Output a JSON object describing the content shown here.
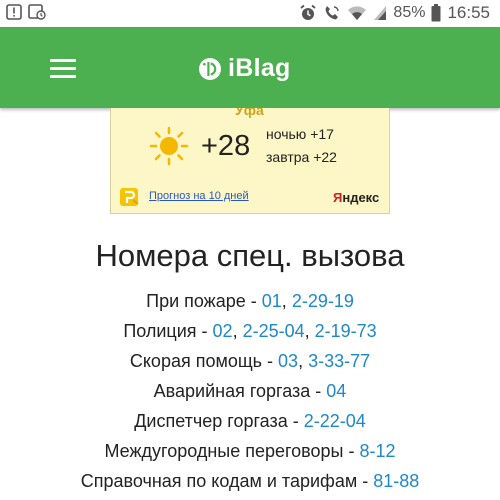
{
  "status_bar": {
    "battery_percent": "85%",
    "time": "16:55",
    "left_icons": [
      "warning-icon",
      "gallery-icon"
    ],
    "right_icons": [
      "alarm-icon",
      "call-icon",
      "wifi-icon",
      "signal-icon",
      "battery-icon"
    ]
  },
  "app_bar": {
    "title": "iBlag",
    "menu_icon": "hamburger-menu-icon",
    "logo_icon": "iblag-logo-icon",
    "background_color": "#4caf50"
  },
  "weather": {
    "city": "Уфа",
    "temperature": "+28",
    "night": "ночью +17",
    "tomorrow": "завтра +22",
    "forecast_link": "Прогноз на 10 дней",
    "provider": "Яндекс",
    "provider_first_letter": "Я",
    "provider_rest": "ндекс"
  },
  "section": {
    "title": "Номера спец. вызова",
    "link_color": "#1e88c8"
  },
  "rows": [
    {
      "label": "При пожаре - ",
      "numbers": [
        "01",
        "2-29-19"
      ]
    },
    {
      "label": "Полиция - ",
      "numbers": [
        "02",
        "2-25-04",
        "2-19-73"
      ]
    },
    {
      "label": "Скорая помощь - ",
      "numbers": [
        "03",
        "3-33-77"
      ]
    },
    {
      "label": "Аварийная горгаза - ",
      "numbers": [
        "04"
      ]
    },
    {
      "label": "Диспетчер горгаза - ",
      "numbers": [
        "2-22-04"
      ]
    },
    {
      "label": "Междугородные переговоры - ",
      "numbers": [
        "8-12"
      ]
    },
    {
      "label": "Справочная по кодам и тарифам - ",
      "numbers": [
        "81-88"
      ]
    }
  ]
}
